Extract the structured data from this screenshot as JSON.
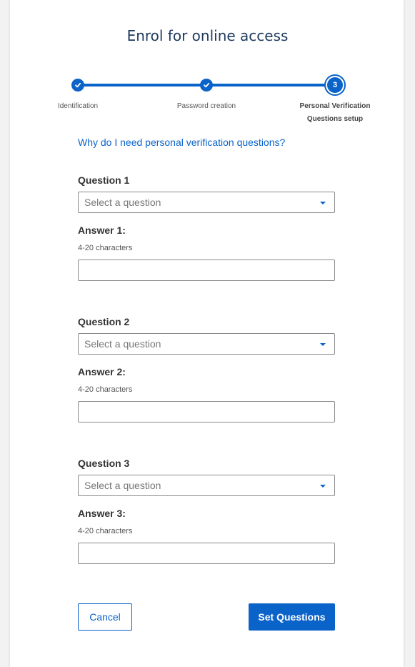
{
  "title": "Enrol for online access",
  "steps": [
    {
      "label": "Identification",
      "status": "complete"
    },
    {
      "label": "Password creation",
      "status": "complete"
    },
    {
      "label_line1": "Personal Verification",
      "label_line2": "Questions setup",
      "number": "3",
      "status": "current"
    }
  ],
  "help_link": "Why do I need personal verification questions?",
  "questions": [
    {
      "question_label": "Question 1",
      "select_placeholder": "Select a question",
      "answer_label": "Answer 1:",
      "answer_hint": "4-20 characters",
      "answer_value": ""
    },
    {
      "question_label": "Question 2",
      "select_placeholder": "Select a question",
      "answer_label": "Answer 2:",
      "answer_hint": "4-20 characters",
      "answer_value": ""
    },
    {
      "question_label": "Question 3",
      "select_placeholder": "Select a question",
      "answer_label": "Answer 3:",
      "answer_hint": "4-20 characters",
      "answer_value": ""
    }
  ],
  "buttons": {
    "cancel": "Cancel",
    "submit": "Set Questions"
  },
  "colors": {
    "accent": "#0a63c9",
    "title": "#1e3a5f"
  },
  "icons": {
    "complete_step": "check-icon",
    "dropdown": "caret-down-icon"
  }
}
